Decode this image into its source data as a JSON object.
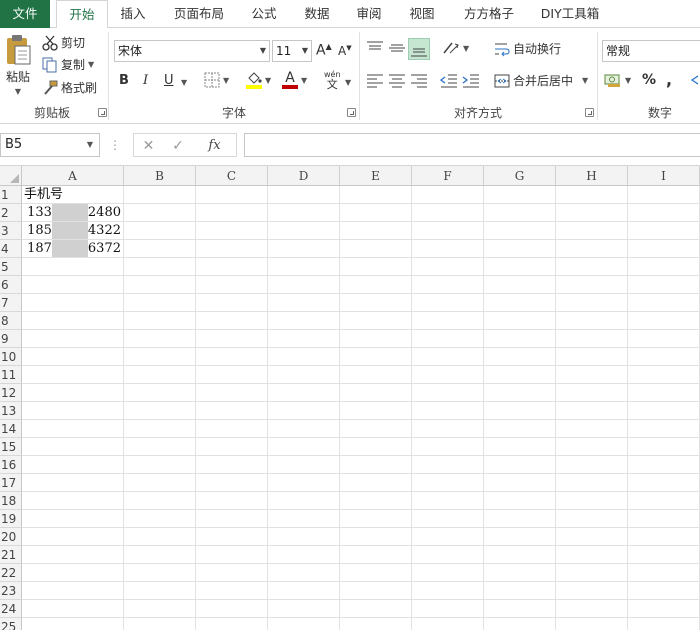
{
  "tabs": [
    {
      "label": "文件"
    },
    {
      "label": "开始"
    },
    {
      "label": "插入"
    },
    {
      "label": "页面布局"
    },
    {
      "label": "公式"
    },
    {
      "label": "数据"
    },
    {
      "label": "审阅"
    },
    {
      "label": "视图"
    },
    {
      "label": "方方格子"
    },
    {
      "label": "DIY工具箱"
    }
  ],
  "ribbon": {
    "clipboard": {
      "paste": "粘贴",
      "cut": "剪切",
      "copy": "复制",
      "format_painter": "格式刷",
      "group": "剪贴板"
    },
    "font": {
      "name": "宋体",
      "size": "11",
      "bold": "B",
      "italic": "I",
      "underline": "U",
      "phonetic_top": "wén",
      "phonetic_bottom": "文",
      "group": "字体",
      "font_color": "#c00000",
      "fill_color": "#ffff00"
    },
    "alignment": {
      "wrap": "自动换行",
      "merge": "合并后居中",
      "group": "对齐方式"
    },
    "number": {
      "format": "常规",
      "percent": "%",
      "comma": ",",
      "group": "数字"
    }
  },
  "formula_bar": {
    "name_box": "B5",
    "fx": "fx",
    "value": ""
  },
  "grid": {
    "columns": [
      "A",
      "B",
      "C",
      "D",
      "E",
      "F",
      "G",
      "H",
      "I"
    ],
    "rows": [
      "1",
      "2",
      "3",
      "4",
      "5",
      "6",
      "7",
      "8",
      "9",
      "10",
      "11",
      "12",
      "13",
      "14",
      "15",
      "16",
      "17",
      "18",
      "19",
      "20",
      "21",
      "22",
      "23",
      "24",
      "25"
    ],
    "cells": {
      "A1": "手机号",
      "A2": {
        "prefix": "133",
        "suffix": "2480"
      },
      "A3": {
        "prefix": "185",
        "suffix": "4322"
      },
      "A4": {
        "prefix": "187",
        "suffix": "6372"
      }
    }
  },
  "colors": {
    "accent": "#217346",
    "selected_align_bg": "#c7e6d2"
  }
}
